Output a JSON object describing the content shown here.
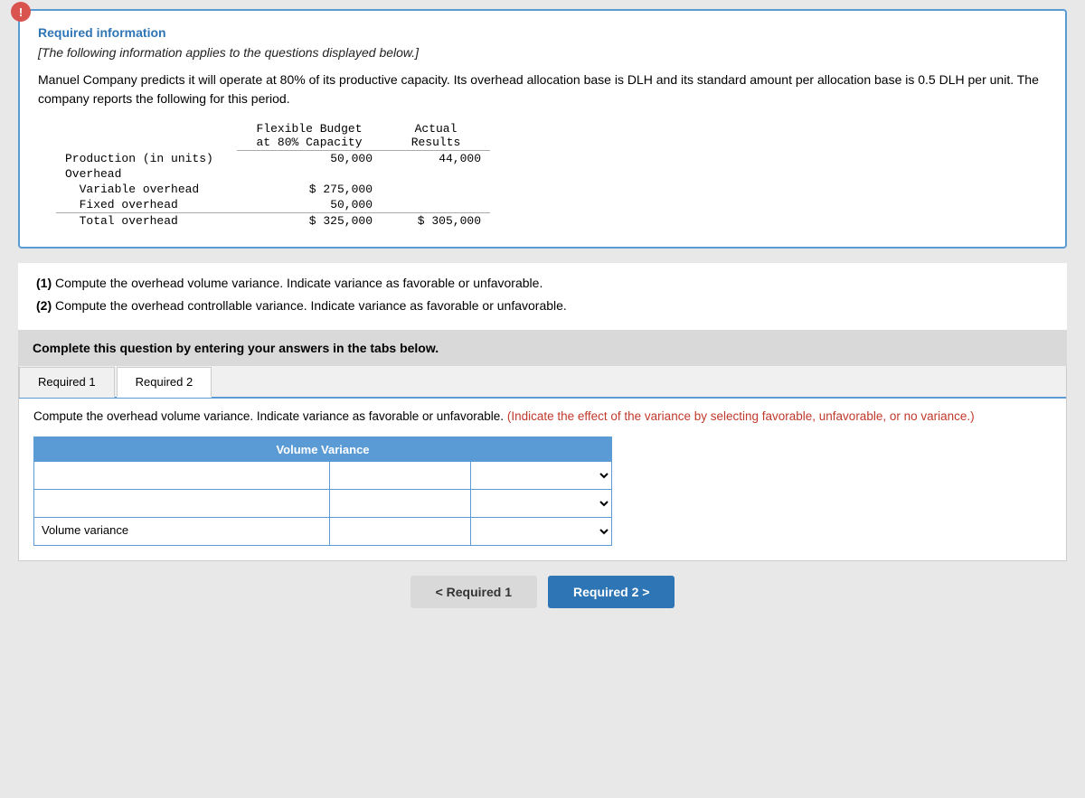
{
  "alert": {
    "icon": "!"
  },
  "info_box": {
    "title": "Required information",
    "italic_note": "[The following information applies to the questions displayed below.]",
    "description": "Manuel Company predicts it will operate at 80% of its productive capacity. Its overhead allocation base is DLH and its standard amount per allocation base is 0.5 DLH per unit. The company reports the following for this period."
  },
  "table": {
    "headers": [
      "",
      "Flexible Budget\nat 80% Capacity",
      "Actual\nResults"
    ],
    "rows": [
      {
        "label": "Production (in units)",
        "flexible": "50,000",
        "actual": "44,000"
      },
      {
        "label": "Overhead",
        "flexible": "",
        "actual": ""
      },
      {
        "label": "  Variable overhead",
        "flexible": "$ 275,000",
        "actual": ""
      },
      {
        "label": "  Fixed overhead",
        "flexible": "50,000",
        "actual": ""
      },
      {
        "label": "  Total overhead",
        "flexible": "$ 325,000",
        "actual": "$ 305,000"
      }
    ]
  },
  "questions": [
    "(1) Compute the overhead volume variance. Indicate variance as favorable or unfavorable.",
    "(2) Compute the overhead controllable variance. Indicate variance as favorable or unfavorable."
  ],
  "instruction_bar": {
    "text": "Complete this question by entering your answers in the tabs below."
  },
  "tabs": [
    {
      "label": "Required 1",
      "active": false
    },
    {
      "label": "Required 2",
      "active": true
    }
  ],
  "tab_content": {
    "description_start": "Compute the overhead volume variance. Indicate variance as favorable or unfavorable.",
    "description_highlight": " (Indicate the effect of the variance by selecting favorable, unfavorable, or no variance.)",
    "volume_variance_header": "Volume Variance",
    "rows": [
      {
        "label": "",
        "input_value": "",
        "dropdown_value": ""
      },
      {
        "label": "",
        "input_value": "",
        "dropdown_value": ""
      },
      {
        "label": "Volume variance",
        "input_value": "",
        "dropdown_value": ""
      }
    ]
  },
  "nav_buttons": {
    "prev_label": "< Required 1",
    "next_label": "Required 2 >"
  }
}
